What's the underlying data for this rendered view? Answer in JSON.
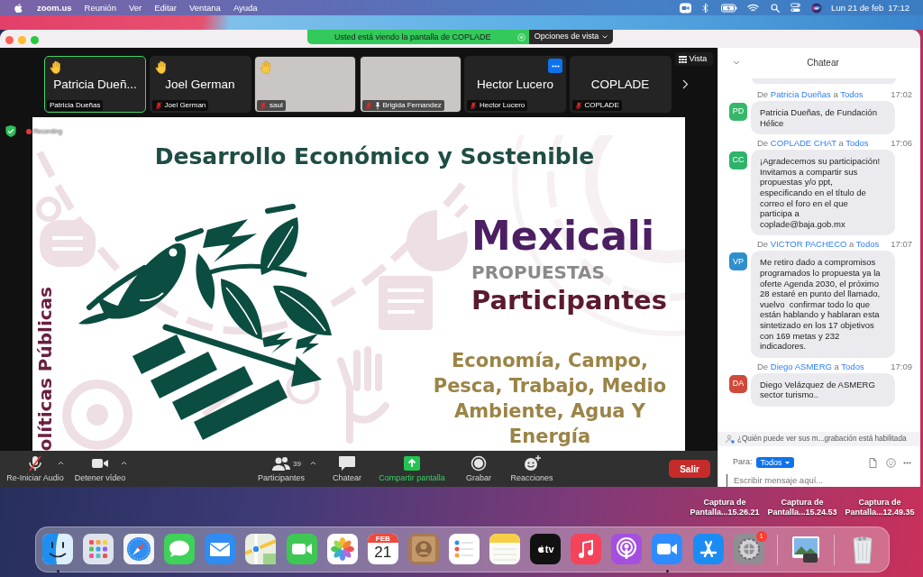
{
  "menu_bar": {
    "app_name": "zoom.us",
    "menus": [
      "Reunión",
      "Ver",
      "Editar",
      "Ventana",
      "Ayuda"
    ],
    "date": "Lun 21 de feb",
    "time": "17:12"
  },
  "window": {
    "share_banner": "Usted está viendo la pantalla de COPLADE",
    "view_options": "Opciones de vista"
  },
  "gallery": {
    "tiles": [
      {
        "kind": "name",
        "display_name": "Patricia Dueñ...",
        "label": "Patricia Dueñas",
        "active": true,
        "hand_raised": true,
        "muted": false,
        "pinned": false,
        "options_shown": false
      },
      {
        "kind": "name",
        "display_name": "Joel German",
        "label": "Joel German",
        "active": false,
        "hand_raised": true,
        "muted": true,
        "pinned": false,
        "options_shown": false
      },
      {
        "kind": "video",
        "label": "saul",
        "active": false,
        "hand_raised": true,
        "muted": true,
        "pinned": false,
        "options_shown": false
      },
      {
        "kind": "video",
        "label": "Brigida Fernandez",
        "active": false,
        "hand_raised": false,
        "muted": true,
        "pinned": true,
        "options_shown": false
      },
      {
        "kind": "name",
        "display_name": "Hector Lucero",
        "label": "Hector Lucero",
        "active": false,
        "hand_raised": false,
        "muted": true,
        "pinned": false,
        "options_shown": true
      },
      {
        "kind": "name",
        "display_name": "COPLADE",
        "label": "COPLADE",
        "active": false,
        "hand_raised": false,
        "muted": true,
        "pinned": false,
        "options_shown": false
      }
    ],
    "view_button": "Vista"
  },
  "share": {
    "recording": "Recording",
    "slide": {
      "title": "Desarrollo Económico y Sostenible",
      "side_label": "olíticas Públicas",
      "city": "Mexicali",
      "subtitle": "PROPUESTAS",
      "heading": "Participantes",
      "topics": "Economía, Campo, Pesca, Trabajo, Medio Ambiente, Agua Y Energía"
    }
  },
  "toolbar": {
    "left": [
      {
        "kind": "mic_off",
        "label": "Re-Iniciar Audio",
        "caret": true
      },
      {
        "kind": "video",
        "label": "Detener vídeo",
        "caret": true
      }
    ],
    "center": [
      {
        "kind": "participants",
        "label": "Participantes",
        "count": "39",
        "caret": true
      },
      {
        "kind": "chat",
        "label": "Chatear",
        "caret": false
      },
      {
        "kind": "share",
        "label": "Compartir pantalla",
        "caret": false
      },
      {
        "kind": "record",
        "label": "Grabar",
        "caret": false
      },
      {
        "kind": "reactions",
        "label": "Reacciones",
        "caret": false
      }
    ],
    "leave": "Salir"
  },
  "chat": {
    "title": "Chatear",
    "messages": [
      {
        "from_label": "De",
        "sender": "Patricia Dueñas",
        "to_label": "a",
        "recipient": "Todos",
        "time": "17:02",
        "initials": "PD",
        "color": "#35b86b",
        "text": "Patricia Dueñas, de Fundación Hélice"
      },
      {
        "from_label": "De",
        "sender": "COPLADE CHAT",
        "to_label": "a",
        "recipient": "Todos",
        "time": "17:06",
        "initials": "CC",
        "color": "#2fb36a",
        "text": "¡Agradecemos su participación! Invitamos a compartir sus propuestas y/o ppt, especificando en el título de correo el foro en el que participa a coplade@baja.gob.mx"
      },
      {
        "from_label": "De",
        "sender": "VICTOR PACHECO",
        "to_label": "a",
        "recipient": "Todos",
        "time": "17:07",
        "initials": "VP",
        "color": "#2f8fcc",
        "text": "Me retiro dado a compromisos programados lo propuesta ya la oferte Agenda 2030, el próximo 28 estaré en punto del llamado, vuelvo  confirmar todo lo que están hablando y hablaran esta sintetizado en los 17 objetivos con 169 metas y 232 indicadores."
      },
      {
        "from_label": "De",
        "sender": "Diego ASMERG",
        "to_label": "a",
        "recipient": "Todos",
        "time": "17:09",
        "initials": "DA",
        "color": "#cf4a3b",
        "text": "Diego Velázquez de ASMERG sector turismo.."
      }
    ],
    "notice": "¿Quién puede ver sus m...grabación está habilitada",
    "to_label": "Para:",
    "recipient": "Todos",
    "placeholder": "Escribir mensaje aquí..."
  },
  "desktop": {
    "files": [
      {
        "name": "Captura de Pantalla...15.26.21"
      },
      {
        "name": "Captura de Pantalla...15.24.53"
      },
      {
        "name": "Captura de Pantalla...12.49.35"
      }
    ]
  },
  "dock": {
    "apps": [
      {
        "kind": "finder",
        "running": true
      },
      {
        "kind": "launchpad",
        "running": false
      },
      {
        "kind": "safari",
        "running": false
      },
      {
        "kind": "messages",
        "running": false
      },
      {
        "kind": "mail",
        "running": false
      },
      {
        "kind": "maps",
        "running": false
      },
      {
        "kind": "facetime",
        "running": false
      },
      {
        "kind": "photos",
        "running": false
      },
      {
        "kind": "calendar",
        "running": false,
        "month": "FEB",
        "day": "21"
      },
      {
        "kind": "contacts",
        "running": false
      },
      {
        "kind": "reminders",
        "running": false
      },
      {
        "kind": "notes",
        "running": false
      },
      {
        "kind": "tv",
        "running": false,
        "label": "tv"
      },
      {
        "kind": "music",
        "running": false
      },
      {
        "kind": "podcasts",
        "running": false
      },
      {
        "kind": "zoom",
        "running": true
      },
      {
        "kind": "app_store",
        "running": false
      },
      {
        "kind": "settings",
        "running": false,
        "badge": "1"
      }
    ],
    "stack": [
      {
        "kind": "preview",
        "running": false
      }
    ],
    "trash": {
      "kind": "trash"
    }
  }
}
